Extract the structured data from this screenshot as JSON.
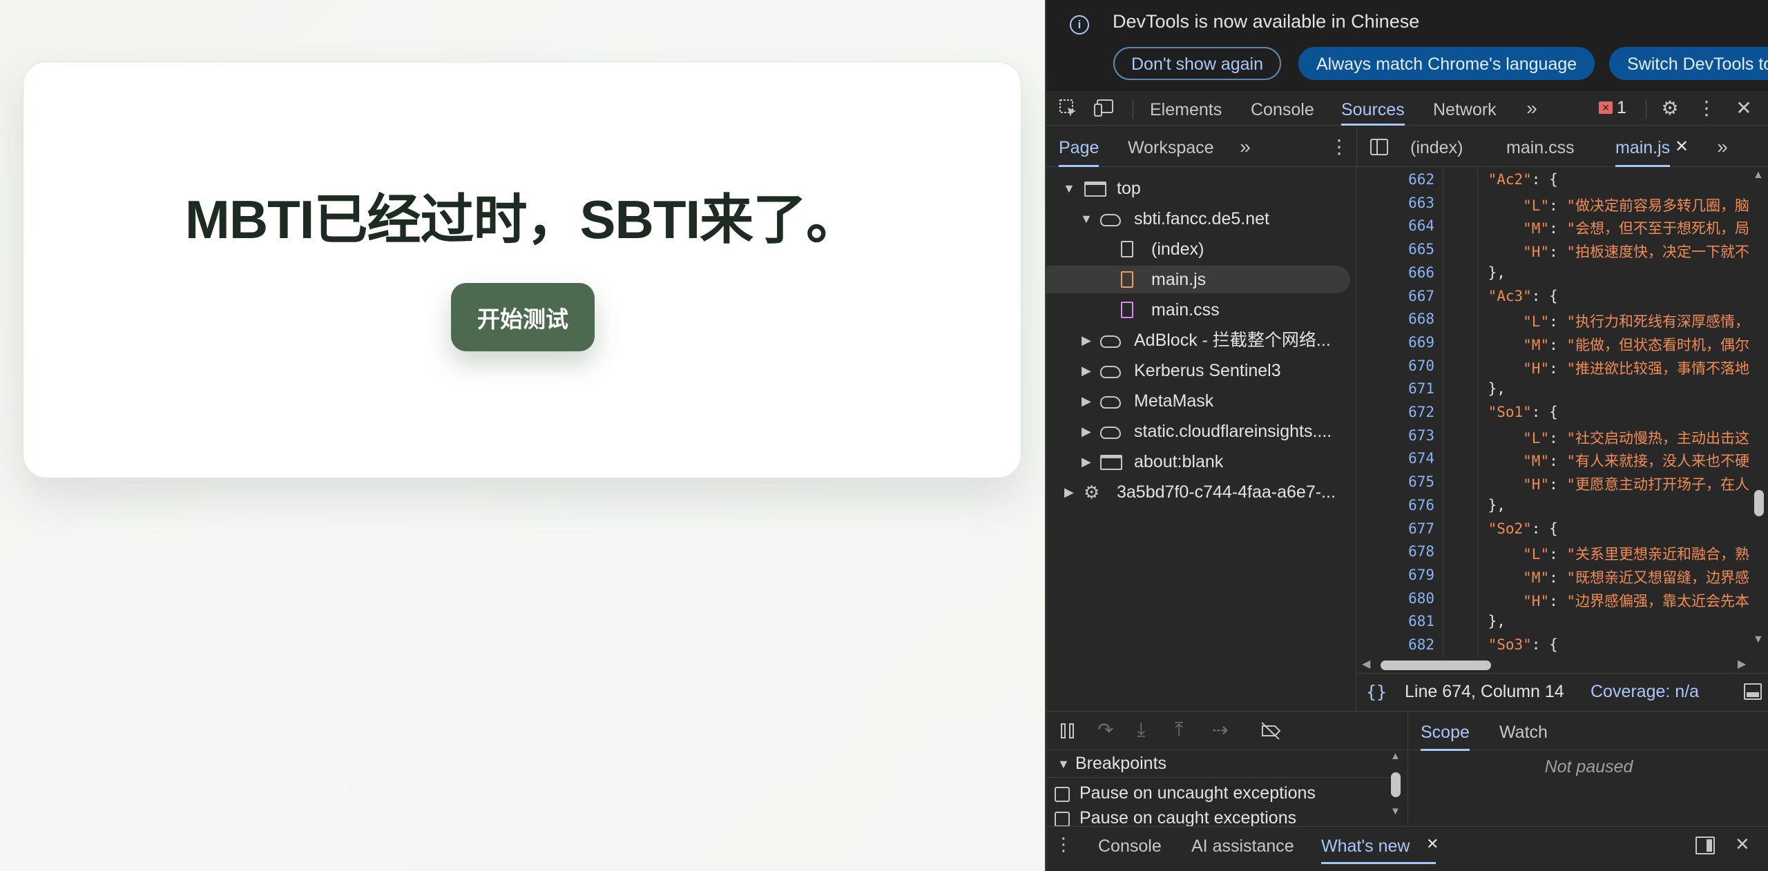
{
  "page": {
    "headline": "MBTI已经过时，SBTI来了。",
    "start_button": "开始测试"
  },
  "devtools": {
    "infobar": {
      "message": "DevTools is now available in Chinese",
      "btn_dont_show": "Don't show again",
      "btn_match": "Always match Chrome's language",
      "btn_switch": "Switch DevTools to"
    },
    "main_tabs": [
      "Elements",
      "Console",
      "Sources",
      "Network"
    ],
    "active_main_tab": "Sources",
    "issues_count": "1",
    "nav_tabs": [
      "Page",
      "Workspace"
    ],
    "editor_tabs": [
      "(index)",
      "main.css",
      "main.js"
    ],
    "tree": {
      "top": "top",
      "domain": "sbti.fancc.de5.net",
      "index": "(index)",
      "mainjs": "main.js",
      "maincss": "main.css",
      "adblock": "AdBlock - 拦截整个网络...",
      "kerberus": "Kerberus Sentinel3",
      "metamask": "MetaMask",
      "cloudflare": "static.cloudflareinsights....",
      "blank": "about:blank",
      "worker": "3a5bd7f0-c744-4faa-a6e7-..."
    },
    "code_lines": [
      {
        "n": "662",
        "t": "    \"Ac2\": {"
      },
      {
        "n": "663",
        "t": "        \"L\": \"做决定前容易多转几圈，脑"
      },
      {
        "n": "664",
        "t": "        \"M\": \"会想，但不至于想死机，局"
      },
      {
        "n": "665",
        "t": "        \"H\": \"拍板速度快，决定一下就不"
      },
      {
        "n": "666",
        "t": "    },"
      },
      {
        "n": "667",
        "t": "    \"Ac3\": {"
      },
      {
        "n": "668",
        "t": "        \"L\": \"执行力和死线有深厚感情，"
      },
      {
        "n": "669",
        "t": "        \"M\": \"能做，但状态看时机，偶尔"
      },
      {
        "n": "670",
        "t": "        \"H\": \"推进欲比较强，事情不落地"
      },
      {
        "n": "671",
        "t": "    },"
      },
      {
        "n": "672",
        "t": "    \"So1\": {"
      },
      {
        "n": "673",
        "t": "        \"L\": \"社交启动慢热，主动出击这"
      },
      {
        "n": "674",
        "t": "        \"M\": \"有人来就接，没人来也不硬"
      },
      {
        "n": "675",
        "t": "        \"H\": \"更愿意主动打开场子，在人"
      },
      {
        "n": "676",
        "t": "    },"
      },
      {
        "n": "677",
        "t": "    \"So2\": {"
      },
      {
        "n": "678",
        "t": "        \"L\": \"关系里更想亲近和融合，熟"
      },
      {
        "n": "679",
        "t": "        \"M\": \"既想亲近又想留缝，边界感"
      },
      {
        "n": "680",
        "t": "        \"H\": \"边界感偏强，靠太近会先本"
      },
      {
        "n": "681",
        "t": "    },"
      },
      {
        "n": "682",
        "t": "    \"So3\": {"
      }
    ],
    "status": {
      "position": "Line 674, Column 14",
      "coverage": "Coverage: n/a"
    },
    "scope_tabs": [
      "Scope",
      "Watch"
    ],
    "not_paused": "Not paused",
    "breakpoints_title": "Breakpoints",
    "bp_uncaught": "Pause on uncaught exceptions",
    "bp_caught": "Pause on caught exceptions",
    "drawer_tabs": [
      "Console",
      "AI assistance",
      "What's new"
    ]
  }
}
